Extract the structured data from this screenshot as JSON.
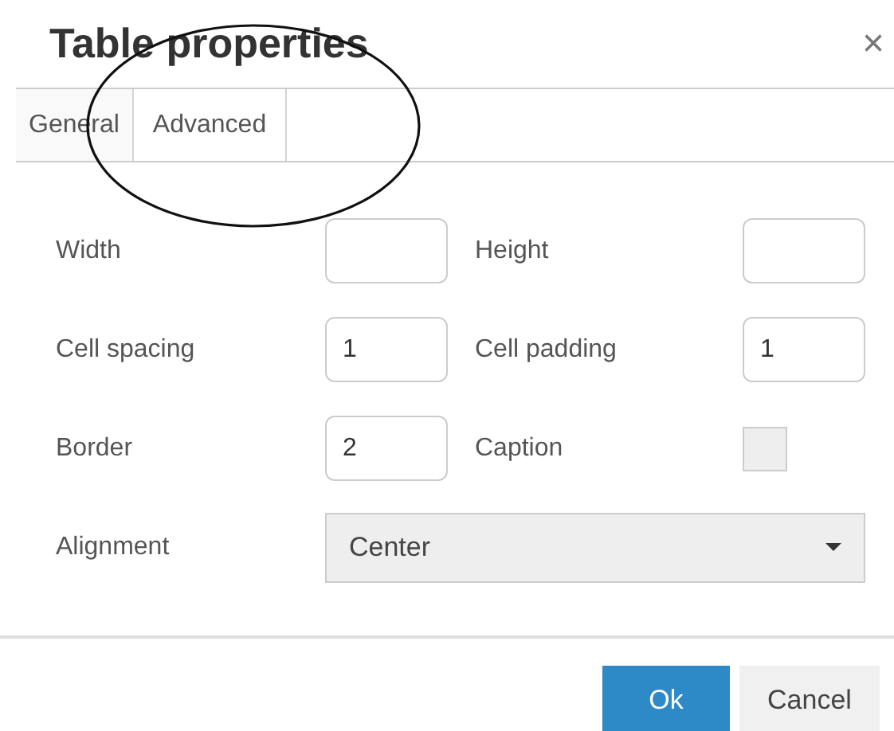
{
  "dialog": {
    "title": "Table properties",
    "close": "×"
  },
  "tabs": [
    {
      "label": "General",
      "selected": true
    },
    {
      "label": "Advanced",
      "selected": false
    }
  ],
  "fields": [
    {
      "kind": "text",
      "label": "Width"
    },
    {
      "kind": "text",
      "label": "Height"
    },
    {
      "kind": "text",
      "label": "Cell spacing",
      "value": "1"
    },
    {
      "kind": "text",
      "label": "Cell padding",
      "value": "1"
    },
    {
      "kind": "text",
      "label": "Border",
      "value": "2"
    },
    {
      "kind": "checkbox",
      "label": "Caption",
      "checked": false
    }
  ],
  "alignment": {
    "label": "Alignment",
    "value": "Center"
  },
  "buttons": [
    {
      "label": "Ok",
      "kind": "primary"
    },
    {
      "label": "Cancel",
      "kind": "secondary"
    }
  ]
}
